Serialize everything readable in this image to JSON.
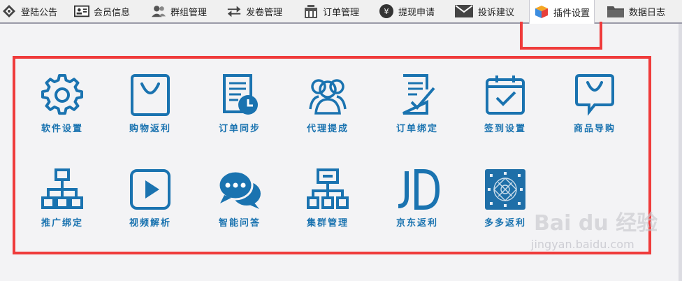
{
  "tabs": [
    {
      "label": "登陆公告",
      "icon": "compass-icon"
    },
    {
      "label": "会员信息",
      "icon": "id-card-icon"
    },
    {
      "label": "群组管理",
      "icon": "users-icon"
    },
    {
      "label": "发卷管理",
      "icon": "swap-arrows-icon"
    },
    {
      "label": "订单管理",
      "icon": "basket-icon"
    },
    {
      "label": "提现申请",
      "icon": "yen-coin-icon"
    },
    {
      "label": "投诉建议",
      "icon": "envelope-icon"
    },
    {
      "label": "插件设置",
      "icon": "cube-icon",
      "active": true
    },
    {
      "label": "数据日志",
      "icon": "folder-icon"
    }
  ],
  "plugins": [
    {
      "label": "软件设置",
      "icon": "gear-icon"
    },
    {
      "label": "购物返利",
      "icon": "shopping-bag-icon"
    },
    {
      "label": "订单同步",
      "icon": "document-clock-icon"
    },
    {
      "label": "代理提成",
      "icon": "agents-icon"
    },
    {
      "label": "订单绑定",
      "icon": "document-check-icon"
    },
    {
      "label": "签到设置",
      "icon": "calendar-check-icon"
    },
    {
      "label": "商品导购",
      "icon": "chat-bag-icon"
    },
    {
      "label": "推广绑定",
      "icon": "org-chart-icon"
    },
    {
      "label": "视频解析",
      "icon": "play-icon"
    },
    {
      "label": "智能问答",
      "icon": "chat-bubbles-icon"
    },
    {
      "label": "集群管理",
      "icon": "network-icon"
    },
    {
      "label": "京东返利",
      "icon": "jd-logo-icon"
    },
    {
      "label": "多多返利",
      "icon": "pinduoduo-logo-icon"
    }
  ],
  "watermark": {
    "brand": "Bai du 经验",
    "url": "jingyan.baidu.com"
  },
  "colors": {
    "accent": "#1a73b0",
    "highlight": "#ef3b3b"
  }
}
